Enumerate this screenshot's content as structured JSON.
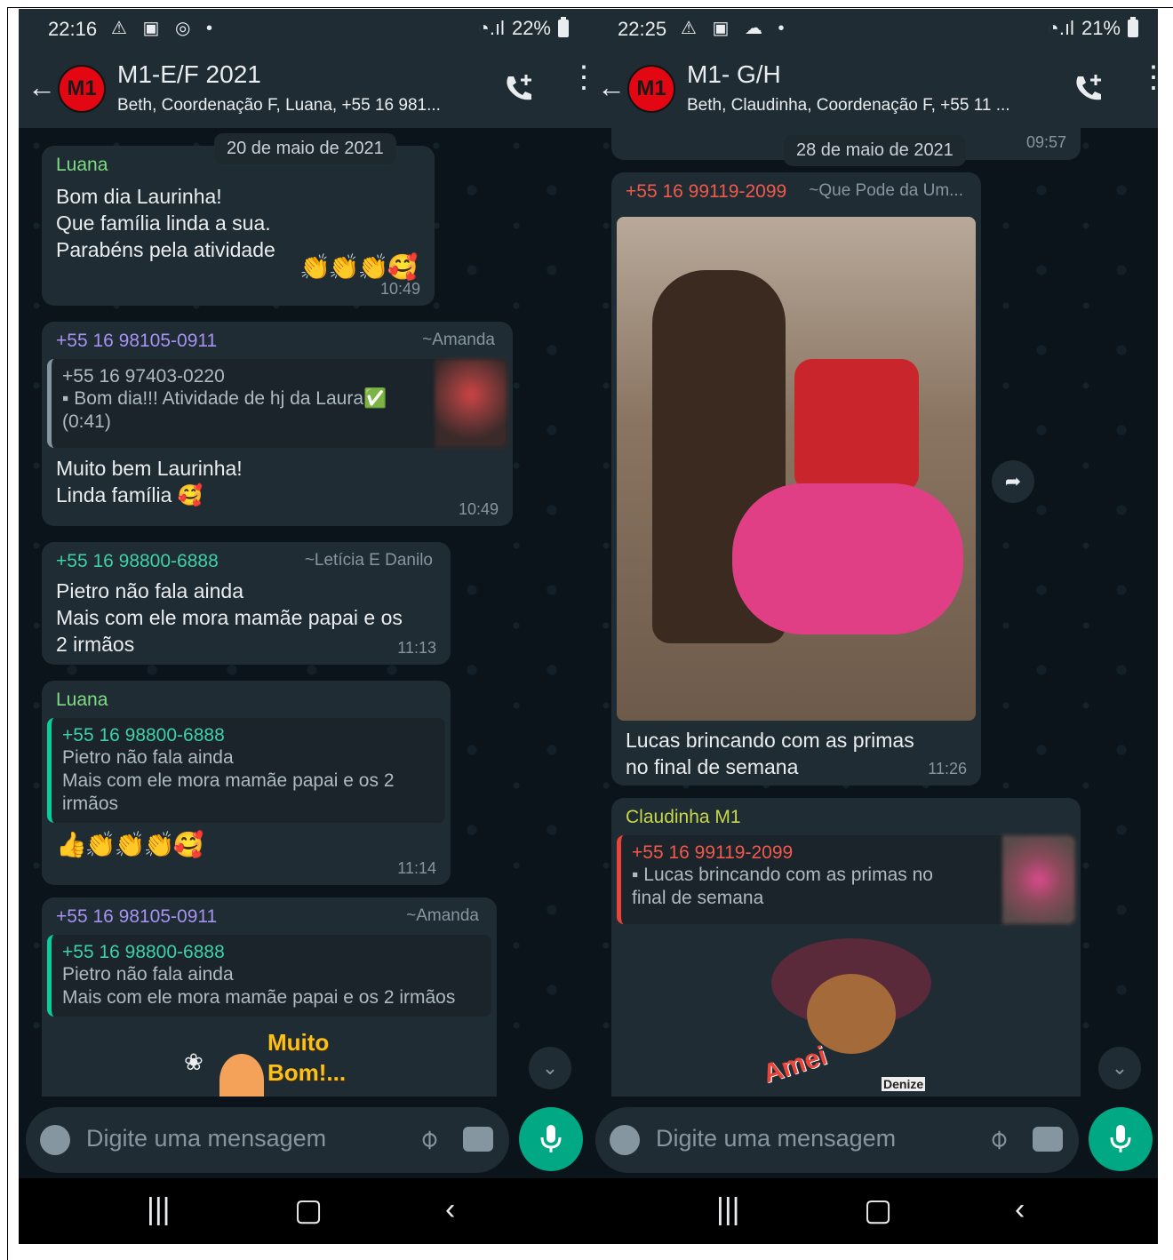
{
  "left": {
    "status": {
      "time": "22:16",
      "battery": "22%"
    },
    "header": {
      "title": "M1-E/F  2021",
      "avatar": "M1",
      "participants": "Beth, Coordenação F, Luana, +55 16 981..."
    },
    "date": "20 de maio de 2021",
    "messages": [
      {
        "sender": "Luana",
        "text": "Bom dia Laurinha!\nQue família linda a sua.\nParabéns pela atividade",
        "emoji": "👏👏👏🥰",
        "time": "10:49"
      },
      {
        "sender": "+55 16 98105-0911",
        "alias": "~Amanda",
        "quote_sender": "+55 16 97403-0220",
        "quote_text": "▪ Bom dia!!!   Atividade de hj da Laura✅\n(0:41)",
        "text": "Muito bem Laurinha!\nLinda família 🥰",
        "time": "10:49"
      },
      {
        "sender": "+55 16 98800-6888",
        "alias": "~Letícia E Danilo",
        "text": "Pietro não fala ainda\nMais com ele mora mamãe papai e os\n2 irmãos",
        "time": "11:13"
      },
      {
        "sender": "Luana",
        "quote_sender": "+55 16 98800-6888",
        "quote_text": "Pietro não fala ainda\nMais com ele mora mamãe papai e os 2\nirmãos",
        "emoji": "👍👏👏👏🥰",
        "time": "11:14"
      },
      {
        "sender": "+55 16 98105-0911",
        "alias": "~Amanda",
        "quote_sender": "+55 16 98800-6888",
        "quote_text": "Pietro não fala ainda\nMais com ele mora mamãe papai e os 2 irmãos",
        "sticker_text": "Muito\nBom!..."
      }
    ],
    "input_placeholder": "Digite uma mensagem"
  },
  "right": {
    "status": {
      "time": "22:25",
      "battery": "21%"
    },
    "header": {
      "title": "M1- G/H",
      "avatar": "M1",
      "participants": "Beth, Claudinha, Coordenação F, +55 11 ..."
    },
    "date": "28 de maio de 2021",
    "date_time": "09:57",
    "messages": [
      {
        "sender": "+55 16 99119-2099",
        "alias": "~Que Pode da Um...",
        "text": "Lucas brincando com as primas\nno final de semana",
        "time": "11:26"
      },
      {
        "sender": "Claudinha M1",
        "quote_sender": "+55 16 99119-2099",
        "quote_text": "▪ Lucas brincando com as primas no\nfinal de semana",
        "sticker_text": "Amei",
        "sticker_sig": "Denize"
      }
    ],
    "input_placeholder": "Digite uma mensagem"
  },
  "colors": {
    "luana": "#7fdc84",
    "amanda": "#a592f2",
    "leticia": "#3fd0a8",
    "claudinha": "#c7d74a",
    "red_sender": "#f2594b",
    "quote_green": "#06cf9c",
    "quote_red": "#e8443a",
    "fab": "#00a884"
  }
}
